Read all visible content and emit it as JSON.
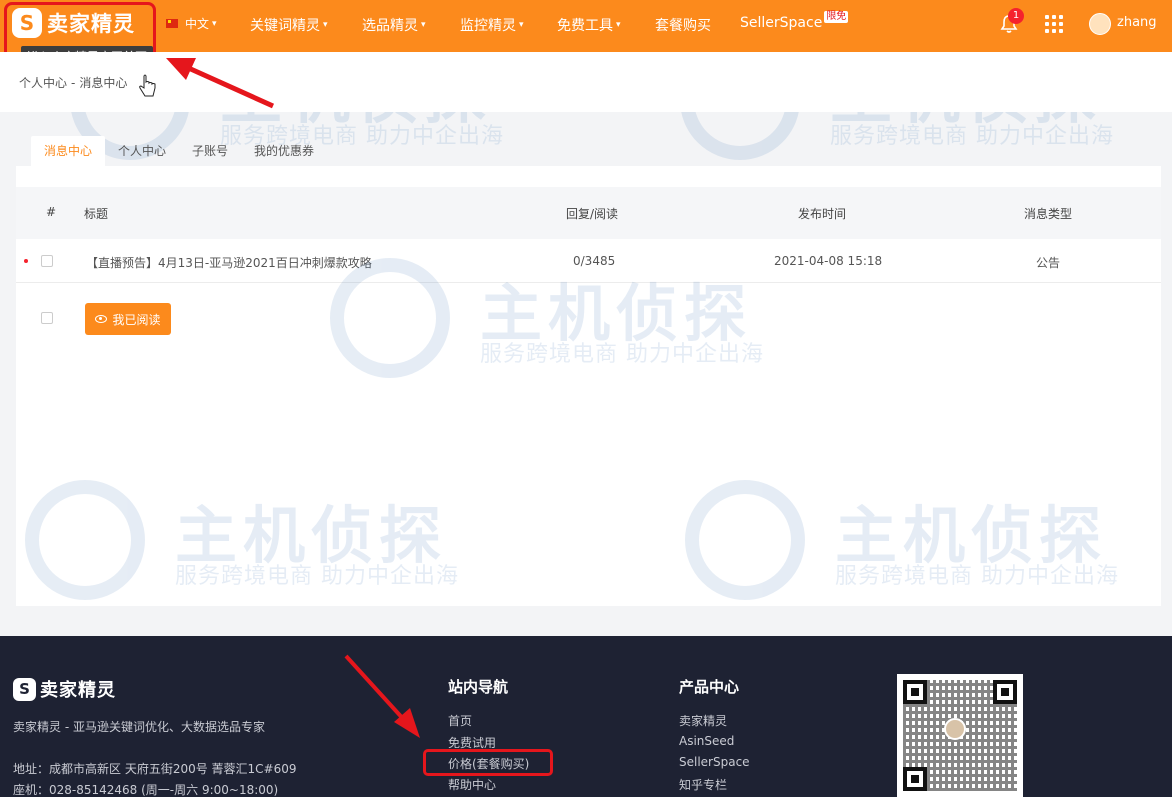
{
  "brand": {
    "name": "卖家精灵",
    "tooltip": "进入卖家精灵官网首页"
  },
  "nav": {
    "language": "中文",
    "items": [
      "关键词精灵",
      "选品精灵",
      "监控精灵",
      "免费工具",
      "套餐购买",
      "SellerSpace"
    ],
    "free_badge": "限免",
    "notification_count": "1",
    "username": "zhang"
  },
  "breadcrumb": {
    "root": "个人中心",
    "sep": "-",
    "current": "消息中心"
  },
  "tabs": [
    "消息中心",
    "个人中心",
    "子账号",
    "我的优惠券"
  ],
  "table": {
    "headers": {
      "index": "#",
      "title": "标题",
      "reply_read": "回复/阅读",
      "publish_time": "发布时间",
      "type": "消息类型"
    },
    "rows": [
      {
        "title": "【直播预告】4月13日-亚马逊2021百日冲刺爆款攻略",
        "reply_read": "0/3485",
        "publish_time": "2021-04-08 15:18",
        "type": "公告"
      }
    ],
    "mark_read_label": "我已阅读"
  },
  "watermark": {
    "title": "主机侦探",
    "subtitle": "服务跨境电商 助力中企出海"
  },
  "footer": {
    "brand": "卖家精灵",
    "tagline": "卖家精灵 - 亚马逊关键词优化、大数据选品专家",
    "address": "地址：成都市高新区 天府五街200号 菁蓉汇1C#609",
    "phone": "座机：028-85142468 (周一-周六 9:00~18:00)",
    "nav_heading": "站内导航",
    "nav_links": [
      "首页",
      "免费试用",
      "价格(套餐购买)",
      "帮助中心"
    ],
    "product_heading": "产品中心",
    "product_links": [
      "卖家精灵",
      "AsinSeed",
      "SellerSpace",
      "知乎专栏"
    ]
  },
  "colors": {
    "accent": "#fc8a1c",
    "annotation_red": "#e5161c",
    "footer_bg": "#1e2233"
  }
}
